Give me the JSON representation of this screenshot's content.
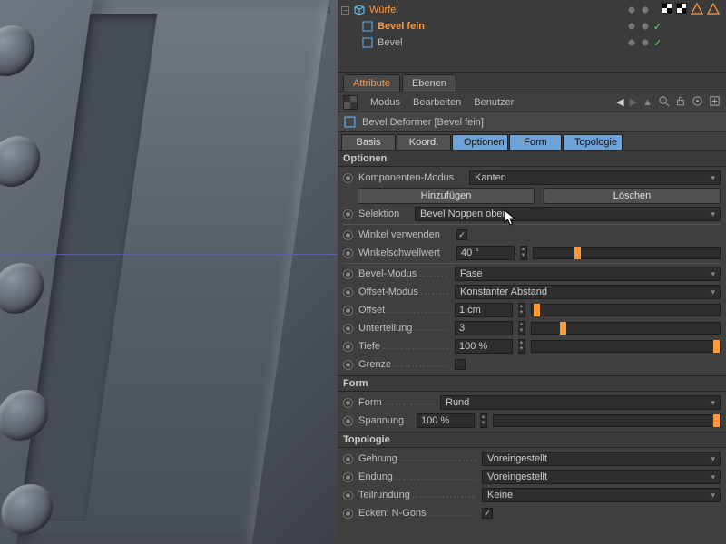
{
  "outliner": {
    "root": "Würfel",
    "children": [
      {
        "name": "Bevel fein",
        "selected": true
      },
      {
        "name": "Bevel",
        "selected": false
      }
    ]
  },
  "attribute_tabs": {
    "active": "Attribute",
    "other": "Ebenen"
  },
  "menu": {
    "mode": "Modus",
    "edit": "Bearbeiten",
    "user": "Benutzer"
  },
  "object_header": "Bevel Deformer [Bevel fein]",
  "subtabs": {
    "basis": "Basis",
    "koord": "Koord.",
    "optionen": "Optionen",
    "form": "Form",
    "topologie": "Topologie"
  },
  "sections": {
    "optionen": "Optionen",
    "form": "Form",
    "topologie": "Topologie"
  },
  "labels": {
    "komponenten_modus": "Komponenten-Modus",
    "hinzufuegen": "Hinzufügen",
    "loeschen": "Löschen",
    "selektion": "Selektion",
    "winkel_verwenden": "Winkel verwenden",
    "winkelschwellwert": "Winkelschwellwert",
    "bevel_modus": "Bevel-Modus",
    "offset_modus": "Offset-Modus",
    "offset": "Offset",
    "unterteilung": "Unterteilung",
    "tiefe": "Tiefe",
    "grenze": "Grenze",
    "form_field": "Form",
    "spannung": "Spannung",
    "gehrung": "Gehrung",
    "endung": "Endung",
    "teilrundung": "Teilrundung",
    "ecken_ngons": "Ecken: N-Gons"
  },
  "values": {
    "komponenten_modus": "Kanten",
    "selektion": "Bevel Noppen oben",
    "winkel_verwenden": true,
    "winkelschwellwert": "40 °",
    "bevel_modus": "Fase",
    "offset_modus": "Konstanter Abstand",
    "offset": "1 cm",
    "unterteilung": "3",
    "tiefe": "100 %",
    "grenze": false,
    "form_field": "Rund",
    "spannung": "100 %",
    "gehrung": "Voreingestellt",
    "endung": "Voreingestellt",
    "teilrundung": "Keine",
    "ecken_ngons": true
  },
  "slider_positions": {
    "winkelschwellwert": 22,
    "offset": 1,
    "unterteilung": 15,
    "tiefe": 100,
    "spannung": 100
  }
}
